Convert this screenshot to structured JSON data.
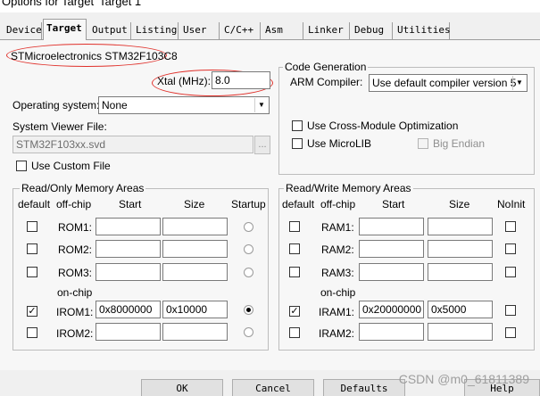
{
  "window": {
    "title": "Options for Target 'Target 1'"
  },
  "tabs": [
    "Device",
    "Target",
    "Output",
    "Listing",
    "User",
    "C/C++",
    "Asm",
    "Linker",
    "Debug",
    "Utilities"
  ],
  "device": {
    "name": "STMicroelectronics STM32F103C8"
  },
  "xtal": {
    "label": "Xtal (MHz):",
    "value": "8.0"
  },
  "os": {
    "label": "Operating system:",
    "value": "None"
  },
  "svf": {
    "label": "System Viewer File:",
    "value": "STM32F103xx.svd",
    "browse": "..."
  },
  "custom_file": {
    "label": "Use Custom File",
    "checked": false
  },
  "codegen": {
    "title": "Code Generation",
    "compiler_label": "ARM Compiler:",
    "compiler_value": "Use default compiler version 5",
    "cross_module": "Use Cross-Module Optimization",
    "microlib": "Use MicroLIB",
    "big_endian": "Big Endian"
  },
  "ro": {
    "title": "Read/Only Memory Areas",
    "headers": {
      "default": "default",
      "offchip": "off-chip",
      "start": "Start",
      "size": "Size",
      "startup": "Startup"
    },
    "onchip": "on-chip",
    "rows": [
      {
        "name": "ROM1:",
        "start": "",
        "size": "",
        "default": false,
        "startup": false
      },
      {
        "name": "ROM2:",
        "start": "",
        "size": "",
        "default": false,
        "startup": false
      },
      {
        "name": "ROM3:",
        "start": "",
        "size": "",
        "default": false,
        "startup": false
      },
      {
        "name": "IROM1:",
        "start": "0x8000000",
        "size": "0x10000",
        "default": true,
        "startup": true
      },
      {
        "name": "IROM2:",
        "start": "",
        "size": "",
        "default": false,
        "startup": false
      }
    ]
  },
  "rw": {
    "title": "Read/Write Memory Areas",
    "headers": {
      "default": "default",
      "offchip": "off-chip",
      "start": "Start",
      "size": "Size",
      "noinit": "NoInit"
    },
    "onchip": "on-chip",
    "rows": [
      {
        "name": "RAM1:",
        "start": "",
        "size": "",
        "default": false
      },
      {
        "name": "RAM2:",
        "start": "",
        "size": "",
        "default": false
      },
      {
        "name": "RAM3:",
        "start": "",
        "size": "",
        "default": false
      },
      {
        "name": "IRAM1:",
        "start": "0x20000000",
        "size": "0x5000",
        "default": true
      },
      {
        "name": "IRAM2:",
        "start": "",
        "size": "",
        "default": false
      }
    ]
  },
  "footer": {
    "ok": "OK",
    "cancel": "Cancel",
    "defaults": "Defaults",
    "help": "Help"
  },
  "watermark": "CSDN @m0_61811389",
  "colors": {
    "annotation": "#e0302a",
    "panel": "#f7f7f7",
    "dialog": "#f0f0f0"
  }
}
